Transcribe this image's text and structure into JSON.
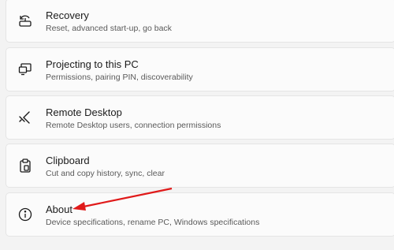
{
  "settings_items": [
    {
      "title": "Recovery",
      "subtitle": "Reset, advanced start-up, go back",
      "icon": "recovery-icon"
    },
    {
      "title": "Projecting to this PC",
      "subtitle": "Permissions, pairing PIN, discoverability",
      "icon": "projecting-icon"
    },
    {
      "title": "Remote Desktop",
      "subtitle": "Remote Desktop users, connection permissions",
      "icon": "remote-desktop-icon"
    },
    {
      "title": "Clipboard",
      "subtitle": "Cut and copy history, sync, clear",
      "icon": "clipboard-icon"
    },
    {
      "title": "About",
      "subtitle": "Device specifications, rename PC, Windows specifications",
      "icon": "info-icon"
    }
  ],
  "annotation": {
    "type": "arrow",
    "color": "#e01a1a",
    "points_to": "About"
  }
}
